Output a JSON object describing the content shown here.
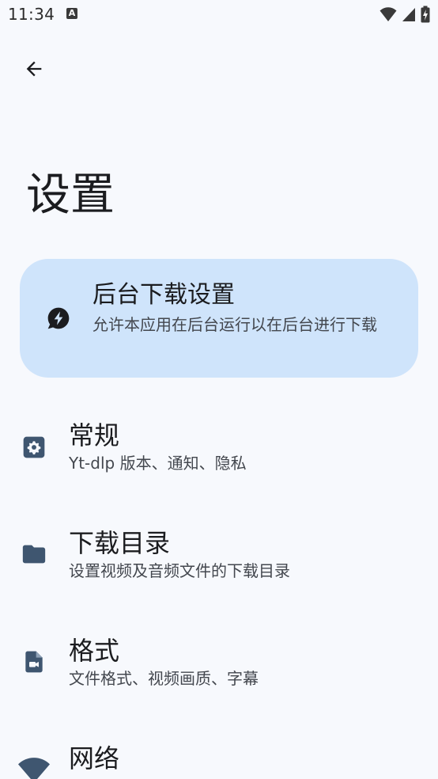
{
  "status_bar": {
    "time": "11:34",
    "notification_letter": "A"
  },
  "header": {
    "title": "设置"
  },
  "banner": {
    "title": "后台下载设置",
    "description": "允许本应用在后台运行以在后台进行下载"
  },
  "items": [
    {
      "title": "常规",
      "description": "Yt-dlp 版本、通知、隐私",
      "icon": "gear-icon"
    },
    {
      "title": "下载目录",
      "description": "设置视频及音频文件的下载目录",
      "icon": "folder-icon"
    },
    {
      "title": "格式",
      "description": "文件格式、视频画质、字幕",
      "icon": "video-file-icon"
    },
    {
      "title": "网络",
      "description": "",
      "icon": "wifi-icon"
    }
  ],
  "colors": {
    "background": "#f7f9fd",
    "banner": "#cfe4fb",
    "icon": "#3f5670"
  }
}
